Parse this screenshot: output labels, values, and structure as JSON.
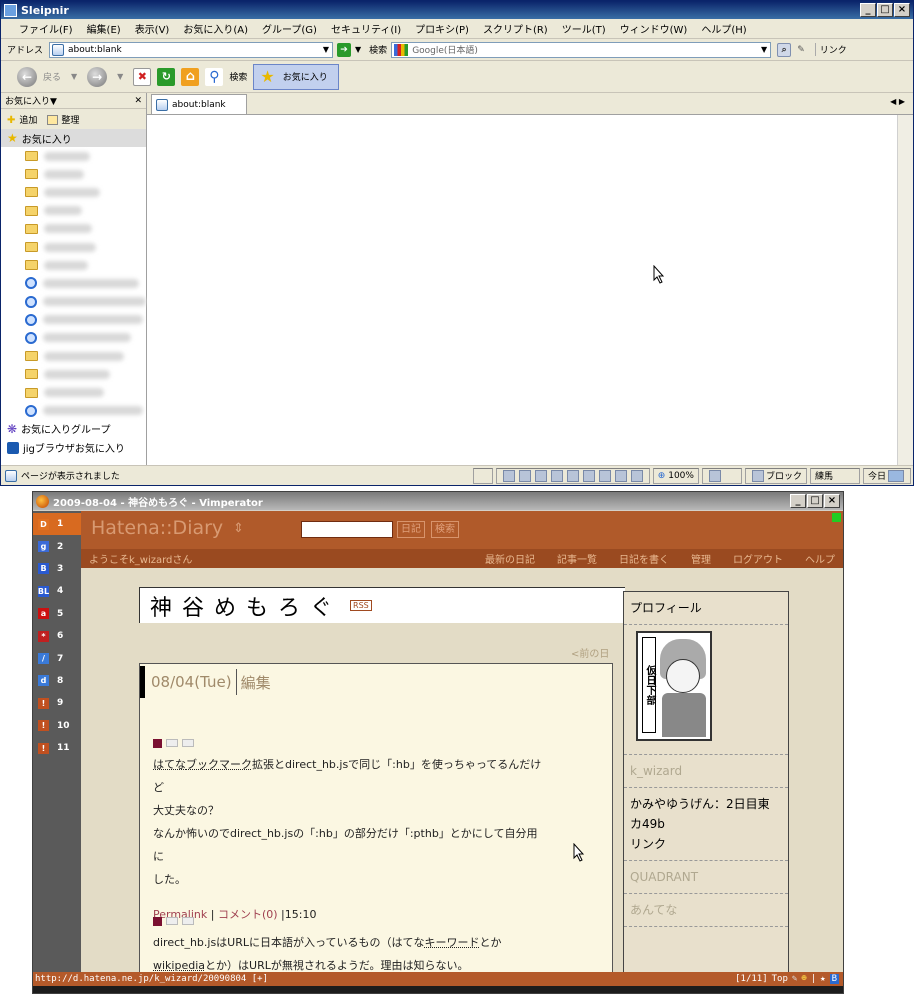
{
  "sleipnir": {
    "title": "Sleipnir",
    "menu": [
      "ファイル(F)",
      "編集(E)",
      "表示(V)",
      "お気に入り(A)",
      "グループ(G)",
      "セキュリティ(I)",
      "プロキシ(P)",
      "スクリプト(R)",
      "ツール(T)",
      "ウィンドウ(W)",
      "ヘルプ(H)"
    ],
    "address_label": "アドレス",
    "address_value": "about:blank",
    "search_label": "検索",
    "search_engine": "Google(日本語)",
    "link_label": "リンク",
    "toolbar": {
      "back": "戻る",
      "search": "検索",
      "favorites": "お気に入り"
    },
    "sidebar": {
      "header": "お気に入り▼",
      "add": "追加",
      "organize": "整理",
      "root": "お気に入り",
      "item_kinds": [
        "folder",
        "folder",
        "folder",
        "folder",
        "folder",
        "folder",
        "folder",
        "ie",
        "ie",
        "ie",
        "ie",
        "folder",
        "folder",
        "folder",
        "ie"
      ],
      "groups": "お気に入りグループ",
      "jig": "jigブラウザお気に入り"
    },
    "tab_title": "about:blank",
    "status": {
      "text": "ページが表示されました",
      "zoom": "100%",
      "block": "ブロック",
      "location": "練馬",
      "today": "今日"
    }
  },
  "vimperator": {
    "title": "2009-08-04 - 神谷めもろぐ - Vimperator",
    "tabs": [
      "1",
      "2",
      "3",
      "4",
      "5",
      "6",
      "7",
      "8",
      "9",
      "10",
      "11"
    ],
    "tab_icons": [
      "D",
      "g",
      "B",
      "BL",
      "a",
      "*",
      "/",
      "d",
      "!",
      "!",
      "!"
    ],
    "tab_colors": [
      "#e07020",
      "#3a6ad8",
      "#2a5ad0",
      "#2a5ad0",
      "#cc1010",
      "#c02020",
      "#3a7ad8",
      "#3a7ad8",
      "#c05020",
      "#c05020",
      "#c05020"
    ],
    "site": {
      "logo": "Hatena::Diary",
      "btn_diary": "日記",
      "btn_search": "検索",
      "welcome": "ようこそk_wizardさん",
      "nav": [
        "最新の日記",
        "記事一覧",
        "日記を書く",
        "管理",
        "ログアウト",
        "ヘルプ"
      ]
    },
    "blog_title": "神谷めもろぐ",
    "rss": "RSS",
    "prev_day": "<前の日",
    "date": "08/04(Tue)",
    "edit": "編集",
    "entry1": {
      "line1_a": "はてな",
      "line1_b": "ブックマーク",
      "line1_c": "拡張とdirect_hb.jsで同じ「:hb」を使っちゃってるんだけど",
      "line2": "大丈夫なの？",
      "line3": "なんか怖いのでdirect_hb.jsの「:hb」の部分だけ「:pthb」とかにして自分用に",
      "line4": "した。",
      "permalink": "Permalink",
      "comments": "コメント(0)",
      "time": "15:10"
    },
    "entry2": {
      "line1_a": "direct_hb.jsはURLに日本語が入っているもの（はてな",
      "line1_b": "キーワード",
      "line1_c": "とか",
      "line2_a": "wikipedia",
      "line2_b": "とか）はURLが無視されるようだ。理由は知らない。"
    },
    "sidebar": {
      "profile": "プロフィール",
      "user": "k_wizard",
      "event": "かみやゆうげん：2日目東",
      "event2": "カ49b",
      "links": "リンク",
      "q": "QUADRANT",
      "antenna": "あんてな",
      "avatar_text": "仮日下部"
    },
    "statusline": {
      "url": "http://d.hatena.ne.jp/k_wizard/20090804 [+]",
      "pos": "[1/11]",
      "top": "Top"
    }
  }
}
